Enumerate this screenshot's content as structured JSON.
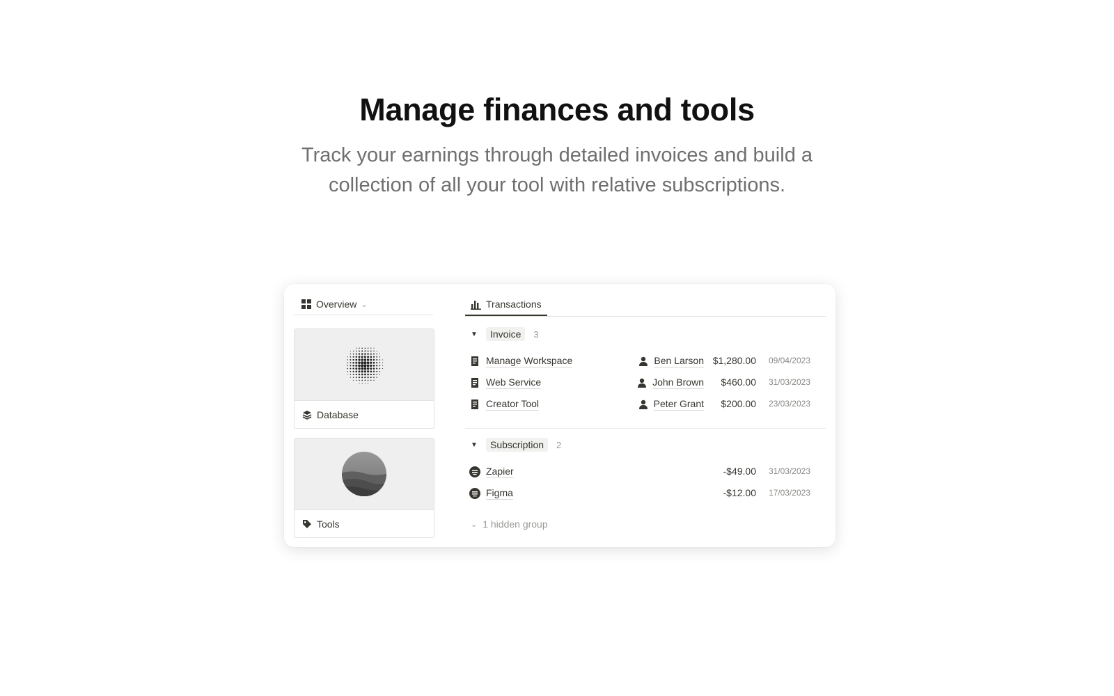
{
  "hero": {
    "title": "Manage finances and tools",
    "subtitle": "Track your earnings through detailed invoices and build a collection of all your tool with relative subscriptions."
  },
  "left": {
    "tab_label": "Overview",
    "tab_icon": "grid-icon",
    "cards": [
      {
        "label": "Database",
        "icon": "layers-icon",
        "cover": "dot-sphere-image"
      },
      {
        "label": "Tools",
        "icon": "tag-icon",
        "cover": "landscape-circle-image"
      }
    ]
  },
  "right": {
    "tab_label": "Transactions",
    "tab_icon": "bar-chart-icon",
    "groups": [
      {
        "label": "Invoice",
        "count": "3",
        "rows": [
          {
            "name": "Manage Workspace",
            "person": "Ben Larson",
            "amount": "$1,280.00",
            "date": "09/04/2023"
          },
          {
            "name": "Web Service",
            "person": "John Brown",
            "amount": "$460.00",
            "date": "31/03/2023"
          },
          {
            "name": "Creator Tool",
            "person": "Peter Grant",
            "amount": "$200.00",
            "date": "23/03/2023"
          }
        ]
      },
      {
        "label": "Subscription",
        "count": "2",
        "rows": [
          {
            "name": "Zapier",
            "amount": "-$49.00",
            "date": "31/03/2023"
          },
          {
            "name": "Figma",
            "amount": "-$12.00",
            "date": "17/03/2023"
          }
        ]
      }
    ],
    "hidden_group_label": "1 hidden group"
  },
  "colors": {
    "text": "#37352f",
    "muted": "#9b9a97",
    "subtitle": "#6f6f6f",
    "cover_bg": "#efefef"
  }
}
